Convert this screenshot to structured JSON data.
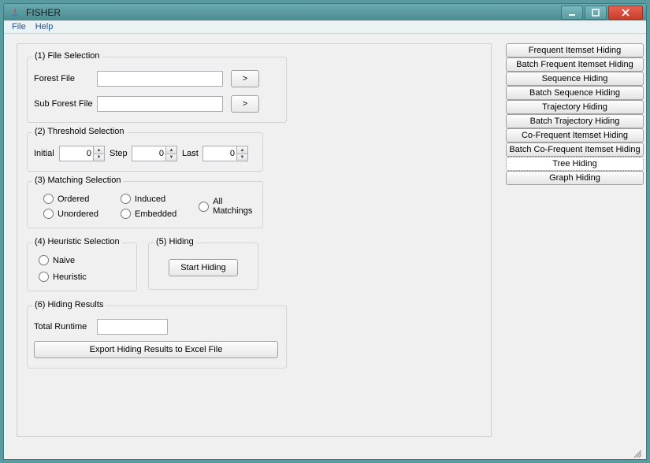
{
  "window": {
    "title": "FISHER",
    "min_tooltip": "Minimize",
    "max_tooltip": "Maximize",
    "close_tooltip": "Close"
  },
  "menu": {
    "file": "File",
    "help": "Help"
  },
  "sections": {
    "file_selection": {
      "title": "(1) File Selection",
      "forest_file_label": "Forest File",
      "forest_file_value": "",
      "sub_forest_file_label": "Sub Forest File",
      "sub_forest_file_value": "",
      "browse_label": ">"
    },
    "threshold_selection": {
      "title": "(2) Threshold Selection",
      "initial_label": "Initial",
      "initial_value": "0",
      "step_label": "Step",
      "step_value": "0",
      "last_label": "Last",
      "last_value": "0"
    },
    "matching_selection": {
      "title": "(3) Matching Selection",
      "ordered": "Ordered",
      "unordered": "Unordered",
      "induced": "Induced",
      "embedded": "Embedded",
      "all_matchings": "All Matchings"
    },
    "heuristic_selection": {
      "title": "(4) Heuristic Selection",
      "naive": "Naive",
      "heuristic": "Heuristic"
    },
    "hiding": {
      "title": "(5) Hiding",
      "start_label": "Start Hiding"
    },
    "hiding_results": {
      "title": "(6) Hiding Results",
      "total_runtime_label": "Total Runtime",
      "total_runtime_value": "",
      "export_label": "Export Hiding Results to Excel File"
    }
  },
  "sidebar": {
    "items": [
      {
        "label": "Frequent Itemset Hiding",
        "selected": false
      },
      {
        "label": "Batch Frequent Itemset Hiding",
        "selected": false
      },
      {
        "label": "Sequence Hiding",
        "selected": false
      },
      {
        "label": "Batch Sequence Hiding",
        "selected": false
      },
      {
        "label": "Trajectory Hiding",
        "selected": false
      },
      {
        "label": "Batch Trajectory Hiding",
        "selected": false
      },
      {
        "label": "Co-Frequent Itemset Hiding",
        "selected": false
      },
      {
        "label": "Batch Co-Frequent Itemset Hiding",
        "selected": false
      },
      {
        "label": "Tree Hiding",
        "selected": true
      },
      {
        "label": "Graph Hiding",
        "selected": false
      }
    ]
  }
}
